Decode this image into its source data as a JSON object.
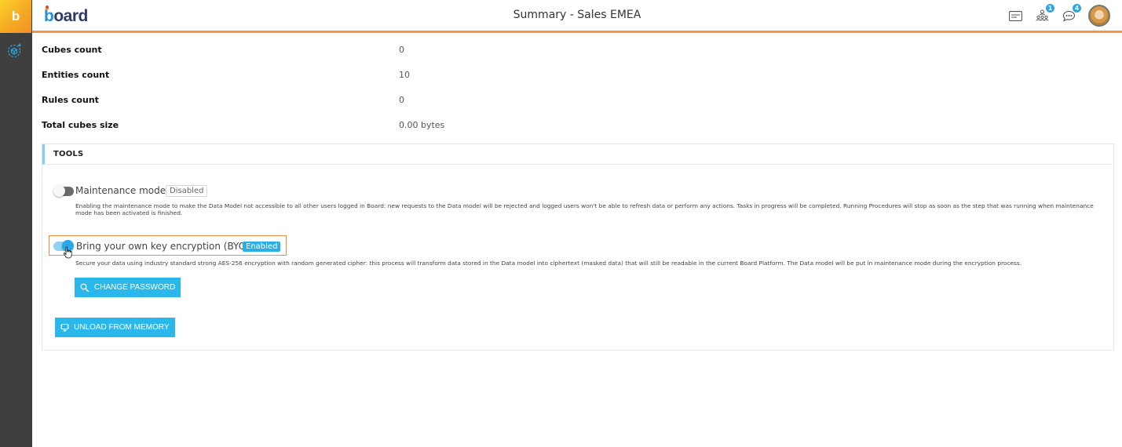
{
  "rail": {
    "logo_letter": "b",
    "items": [
      {
        "icon": "cube-settings-icon"
      }
    ]
  },
  "header": {
    "brand": {
      "first": "b",
      "rest": "oard"
    },
    "title": "Summary - Sales EMEA",
    "icons": [
      {
        "name": "notes-icon",
        "badge": null
      },
      {
        "name": "users-network-icon",
        "badge": "1"
      },
      {
        "name": "chat-icon",
        "badge": "4"
      }
    ],
    "accent_color": "#f5963a"
  },
  "stats": [
    {
      "label": "Cubes count",
      "value": "0"
    },
    {
      "label": "Entities count",
      "value": "10"
    },
    {
      "label": "Rules count",
      "value": "0"
    },
    {
      "label": "Total cubes size",
      "value": "0.00 bytes"
    }
  ],
  "tools": {
    "heading": "TOOLS",
    "maintenance": {
      "label": "Maintenance mode",
      "state": "Disabled",
      "enabled": false,
      "description": "Enabling the maintenance mode to make the Data Model not accessible to all other users logged in Board: new requests to the Data model will be rejected and logged users won't be able to refresh data or perform any actions. Tasks in progress will be completed. Running Procedures will stop as soon as the step that was running when maintenance mode has been activated is finished."
    },
    "byok": {
      "label": "Bring your own key encryption (BYOK)",
      "state": "Enabled",
      "enabled": true,
      "description": "Secure your data using industry standard strong AES-256 encryption with random generated cipher: this process will transform data stored in the Data model into ciphertext (masked data) that will still be readable in the current Board Platform. The Data model will be put in maintenance mode during the encryption process."
    },
    "change_password_label": "CHANGE PASSWORD",
    "unload_label": "UNLOAD FROM MEMORY"
  },
  "colors": {
    "primary_button": "#2ab8ec",
    "enabled_badge": "#2ab0e8",
    "highlight_frame": "#f08a3c"
  }
}
